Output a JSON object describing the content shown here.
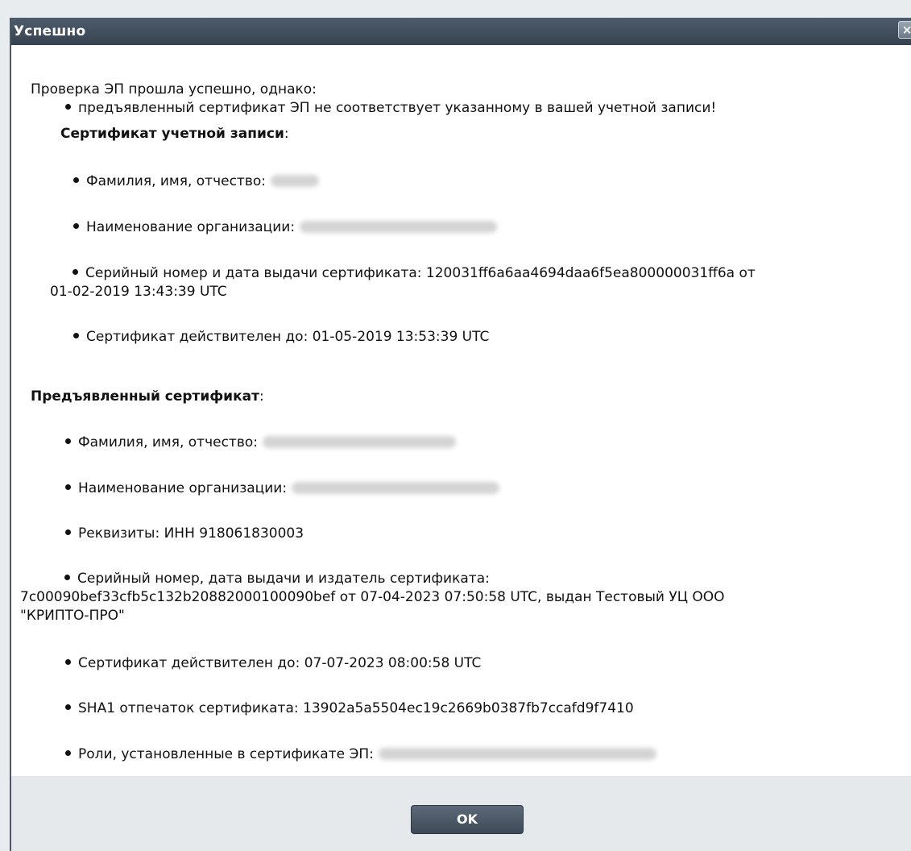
{
  "dialog": {
    "title": "Успешно",
    "close_label": "×"
  },
  "content": {
    "intro": "Проверка ЭП прошла успешно, однако:",
    "warning": "предъявленный сертификат ЭП не соответствует указанному в вашей учетной записи!",
    "account_cert": {
      "heading": "Сертификат учетной записи",
      "heading_suffix": ":",
      "fio_label": "Фамилия, имя, отчество:",
      "org_label": "Наименование организации:",
      "serial_line1": "Серийный номер и дата выдачи сертификата: 120031ff6a6aa4694daa6f5ea800000031ff6a от",
      "serial_line2": "01-02-2019 13:43:39 UTC",
      "valid_until": "Сертификат действителен до: 01-05-2019 13:53:39 UTC"
    },
    "presented_cert": {
      "heading": "Предъявленный сертификат",
      "heading_suffix": ":",
      "fio_label": "Фамилия, имя, отчество:",
      "org_label": "Наименование организации:",
      "requisites": "Реквизиты: ИНН 918061830003",
      "serial_line1": "Серийный номер, дата выдачи и издатель сертификата:",
      "serial_line2": "7c00090bef33cfb5c132b20882000100090bef от 07-04-2023 07:50:58 UTC, выдан Тестовый УЦ ООО",
      "serial_line3": "\"КРИПТО-ПРО\"",
      "valid_until": "Сертификат действителен до: 07-07-2023 08:00:58 UTC",
      "sha1": "SHA1 отпечаток сертификата: 13902a5a5504ec19c2669b0387fb7ccafd9f7410",
      "roles_label": "Роли, установленные в сертификате ЭП:"
    }
  },
  "footer": {
    "ok_label": "OK"
  }
}
